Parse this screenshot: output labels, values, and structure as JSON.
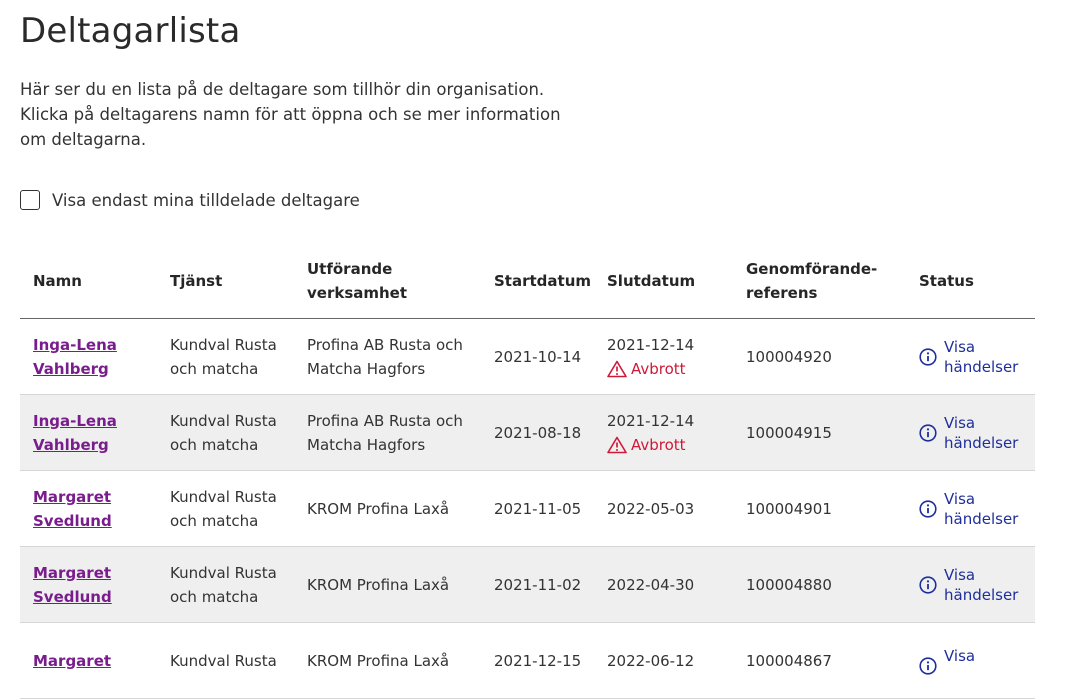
{
  "page": {
    "title": "Deltagarlista",
    "intro": "Här ser du en lista på de deltagare som tillhör din organisation. Klicka på deltagarens namn för att öppna och se mer information om deltagarna."
  },
  "filter": {
    "label": "Visa endast mina tilldelade deltagare",
    "checked": false
  },
  "table": {
    "headers": {
      "namn": "Namn",
      "tjanst": "Tjänst",
      "utforande": "Utförande verksamhet",
      "startdatum": "Startdatum",
      "slutdatum": "Slutdatum",
      "referens": "Genomförande-referens",
      "status": "Status"
    },
    "rows": [
      {
        "namn": "Inga-Lena Vahlberg",
        "tjanst": "Kundval Rusta och matcha",
        "utforande": "Profina AB Rusta och Matcha Hagfors",
        "startdatum": "2021-10-14",
        "slutdatum": "2021-12-14",
        "avbrott": "Avbrott",
        "referens": "100004920",
        "status": "Visa händelser"
      },
      {
        "namn": "Inga-Lena Vahlberg",
        "tjanst": "Kundval Rusta och matcha",
        "utforande": "Profina AB Rusta och Matcha Hagfors",
        "startdatum": "2021-08-18",
        "slutdatum": "2021-12-14",
        "avbrott": "Avbrott",
        "referens": "100004915",
        "status": "Visa händelser"
      },
      {
        "namn": "Margaret Svedlund",
        "tjanst": "Kundval Rusta och matcha",
        "utforande": "KROM Profina Laxå",
        "startdatum": "2021-11-05",
        "slutdatum": "2022-05-03",
        "avbrott": "",
        "referens": "100004901",
        "status": "Visa händelser"
      },
      {
        "namn": "Margaret Svedlund",
        "tjanst": "Kundval Rusta och matcha",
        "utforande": "KROM Profina Laxå",
        "startdatum": "2021-11-02",
        "slutdatum": "2022-04-30",
        "avbrott": "",
        "referens": "100004880",
        "status": "Visa händelser"
      },
      {
        "namn": "Margaret",
        "tjanst": "Kundval Rusta",
        "utforande": "KROM Profina Laxå",
        "startdatum": "2021-12-15",
        "slutdatum": "2022-06-12",
        "avbrott": "",
        "referens": "100004867",
        "status": "Visa"
      }
    ]
  },
  "colors": {
    "name_link": "#7a1d8c",
    "status_link": "#1e2f9c",
    "avbrott": "#d0193a",
    "row_stripe": "#efefef"
  },
  "icons": {
    "warning": "warning-triangle-icon",
    "info": "info-circle-icon"
  }
}
